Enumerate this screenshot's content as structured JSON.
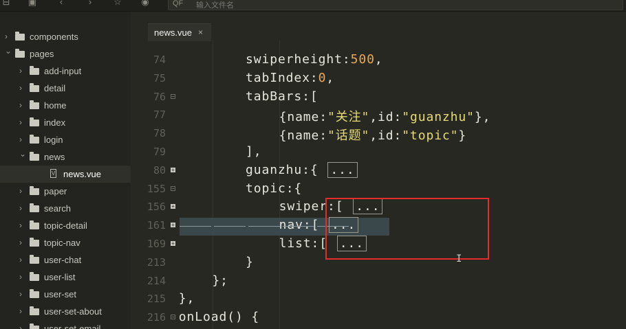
{
  "toolbar": {
    "search_placeholder": "输入文件名",
    "search_icon": "QF"
  },
  "sidebar": {
    "items": [
      {
        "label": "components",
        "type": "folder",
        "expanded": false,
        "depth": 0
      },
      {
        "label": "pages",
        "type": "folder",
        "expanded": true,
        "depth": 0
      },
      {
        "label": "add-input",
        "type": "folder",
        "expanded": false,
        "depth": 1
      },
      {
        "label": "detail",
        "type": "folder",
        "expanded": false,
        "depth": 1
      },
      {
        "label": "home",
        "type": "folder",
        "expanded": false,
        "depth": 1
      },
      {
        "label": "index",
        "type": "folder",
        "expanded": false,
        "depth": 1
      },
      {
        "label": "login",
        "type": "folder",
        "expanded": false,
        "depth": 1
      },
      {
        "label": "news",
        "type": "folder",
        "expanded": true,
        "depth": 1
      },
      {
        "label": "news.vue",
        "type": "file",
        "depth": 2,
        "selected": true
      },
      {
        "label": "paper",
        "type": "folder",
        "expanded": false,
        "depth": 1
      },
      {
        "label": "search",
        "type": "folder",
        "expanded": false,
        "depth": 1
      },
      {
        "label": "topic-detail",
        "type": "folder",
        "expanded": false,
        "depth": 1
      },
      {
        "label": "topic-nav",
        "type": "folder",
        "expanded": false,
        "depth": 1
      },
      {
        "label": "user-chat",
        "type": "folder",
        "expanded": false,
        "depth": 1
      },
      {
        "label": "user-list",
        "type": "folder",
        "expanded": false,
        "depth": 1
      },
      {
        "label": "user-set",
        "type": "folder",
        "expanded": false,
        "depth": 1
      },
      {
        "label": "user-set-about",
        "type": "folder",
        "expanded": false,
        "depth": 1
      },
      {
        "label": "user-set-email",
        "type": "folder",
        "expanded": false,
        "depth": 1
      }
    ]
  },
  "editor": {
    "tab_label": "news.vue",
    "tab_close": "×",
    "lines": [
      {
        "num": "74",
        "fold": "",
        "parts": [
          [
            "k",
            "swiperheight"
          ],
          [
            "p",
            ":"
          ],
          [
            "num",
            "500"
          ],
          [
            "p",
            ","
          ]
        ],
        "indent": 4
      },
      {
        "num": "75",
        "fold": "",
        "parts": [
          [
            "k",
            "tabIndex"
          ],
          [
            "p",
            ":"
          ],
          [
            "num",
            "0"
          ],
          [
            "p",
            ","
          ]
        ],
        "indent": 4
      },
      {
        "num": "76",
        "fold": "open",
        "parts": [
          [
            "k",
            "tabBars"
          ],
          [
            "p",
            ":["
          ]
        ],
        "indent": 4
      },
      {
        "num": "77",
        "fold": "",
        "parts": [
          [
            "p",
            "{name:"
          ],
          [
            "str",
            "\"关注\""
          ],
          [
            "p",
            ",id:"
          ],
          [
            "str",
            "\"guanzhu\""
          ],
          [
            "p",
            "},"
          ]
        ],
        "indent": 5
      },
      {
        "num": "78",
        "fold": "",
        "parts": [
          [
            "p",
            "{name:"
          ],
          [
            "str",
            "\"话题\""
          ],
          [
            "p",
            ",id:"
          ],
          [
            "str",
            "\"topic\""
          ],
          [
            "p",
            "}"
          ]
        ],
        "indent": 5
      },
      {
        "num": "79",
        "fold": "",
        "parts": [
          [
            "p",
            "],"
          ]
        ],
        "indent": 4
      },
      {
        "num": "80",
        "fold": "collapsed",
        "parts": [
          [
            "k",
            "guanzhu"
          ],
          [
            "p",
            ":{ "
          ],
          [
            "ellipsis",
            "..."
          ]
        ],
        "indent": 4
      },
      {
        "num": "155",
        "fold": "open",
        "parts": [
          [
            "k",
            "topic"
          ],
          [
            "p",
            ":{"
          ]
        ],
        "indent": 4
      },
      {
        "num": "156",
        "fold": "collapsed",
        "parts": [
          [
            "k",
            "swiper"
          ],
          [
            "p",
            ":[ "
          ],
          [
            "ellipsis",
            "..."
          ]
        ],
        "indent": 5
      },
      {
        "num": "161",
        "fold": "collapsed",
        "parts": [
          [
            "k",
            "nav"
          ],
          [
            "p",
            ":[ "
          ],
          [
            "ellipsis",
            "..."
          ]
        ],
        "indent": 5
      },
      {
        "num": "169",
        "fold": "collapsed",
        "parts": [
          [
            "k",
            "list"
          ],
          [
            "p",
            ":[ "
          ],
          [
            "ellipsis",
            "..."
          ]
        ],
        "indent": 5
      },
      {
        "num": "213",
        "fold": "",
        "parts": [
          [
            "p",
            "}"
          ]
        ],
        "indent": 4
      },
      {
        "num": "214",
        "fold": "",
        "parts": [
          [
            "p",
            "};"
          ]
        ],
        "indent": 3
      },
      {
        "num": "215",
        "fold": "",
        "parts": [
          [
            "p",
            "},"
          ]
        ],
        "indent": 2
      },
      {
        "num": "216",
        "fold": "open",
        "parts": [
          [
            "k",
            "onLoad"
          ],
          [
            "p",
            "() {"
          ]
        ],
        "indent": 2
      }
    ]
  }
}
